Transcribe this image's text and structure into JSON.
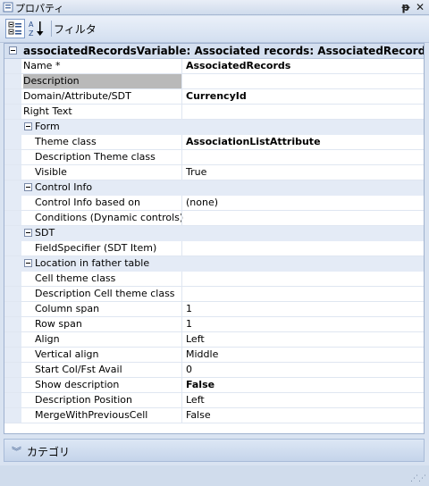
{
  "window": {
    "title": "プロパティ",
    "pin_glyph": "ᵽ",
    "close_glyph": "✕"
  },
  "toolbar": {
    "filter_label": "フィルタ"
  },
  "object_header": "associatedRecordsVariable: Associated records: AssociatedRecords",
  "properties_top": [
    {
      "name": "Name *",
      "value": "AssociatedRecords",
      "bold": true
    },
    {
      "name": "Description",
      "value": "",
      "selected": true
    },
    {
      "name": "Domain/Attribute/SDT",
      "value": "CurrencyId",
      "bold": true
    },
    {
      "name": "Right Text",
      "value": ""
    }
  ],
  "categories": [
    {
      "label": "Form",
      "rows": [
        {
          "name": "Theme class",
          "value": "AssociationListAttribute",
          "bold": true
        },
        {
          "name": "Description Theme class",
          "value": ""
        },
        {
          "name": "Visible",
          "value": "True"
        }
      ]
    },
    {
      "label": "Control Info",
      "rows": [
        {
          "name": "Control Info based on",
          "value": "(none)"
        },
        {
          "name": "Conditions (Dynamic controls)",
          "value": ""
        }
      ]
    },
    {
      "label": "SDT",
      "rows": [
        {
          "name": "FieldSpecifier (SDT Item)",
          "value": ""
        }
      ]
    },
    {
      "label": "Location in father table",
      "rows": [
        {
          "name": "Cell theme class",
          "value": ""
        },
        {
          "name": "Description Cell theme class",
          "value": ""
        },
        {
          "name": "Column span",
          "value": "1"
        },
        {
          "name": "Row span",
          "value": "1"
        },
        {
          "name": "Align",
          "value": "Left"
        },
        {
          "name": "Vertical align",
          "value": "Middle"
        },
        {
          "name": "Start Col/Fst Avail",
          "value": "0"
        },
        {
          "name": "Show description",
          "value": "False",
          "bold": true
        },
        {
          "name": "Description Position",
          "value": "Left"
        },
        {
          "name": "MergeWithPreviousCell",
          "value": "False"
        }
      ]
    }
  ],
  "footer": {
    "label": "カテゴリ"
  }
}
